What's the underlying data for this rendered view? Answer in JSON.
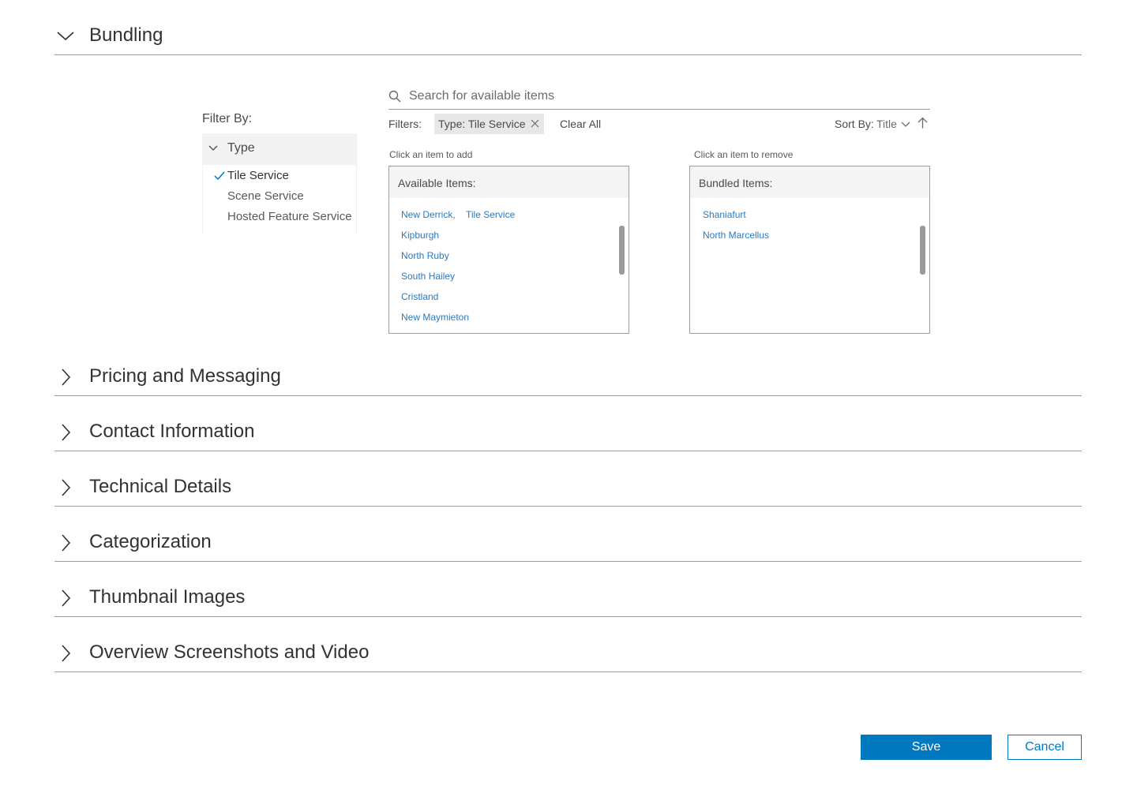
{
  "sections": {
    "bundling": {
      "title": "Bundling",
      "expanded": true
    },
    "pricing": {
      "title": "Pricing and Messaging"
    },
    "contact": {
      "title": "Contact Information"
    },
    "technical": {
      "title": "Technical Details"
    },
    "categorization": {
      "title": "Categorization"
    },
    "thumbnail": {
      "title": "Thumbnail Images"
    },
    "overview": {
      "title": "Overview Screenshots and Video"
    }
  },
  "filter": {
    "label": "Filter By:",
    "group_label": "Type",
    "options": [
      {
        "label": "Tile Service",
        "checked": true
      },
      {
        "label": "Scene Service",
        "checked": false
      },
      {
        "label": "Hosted Feature Service",
        "checked": false
      }
    ]
  },
  "search": {
    "placeholder": "Search for available items"
  },
  "filters_bar": {
    "label": "Filters:",
    "chip": "Type: Tile Service",
    "clear_all": "Clear All"
  },
  "sort": {
    "label": "Sort By:",
    "value": "Title"
  },
  "available": {
    "hint": "Click an item to add",
    "header": "Available Items:",
    "items": [
      "New Derrick,",
      "Kipburgh",
      "North Ruby",
      "South Hailey",
      "Cristland",
      "New Maymieton"
    ],
    "first_item_tag": "Tile Service"
  },
  "bundled": {
    "hint": "Click an item to remove",
    "header": "Bundled Items:",
    "items": [
      "Shaniafurt",
      "North Marcellus"
    ]
  },
  "actions": {
    "save": "Save",
    "cancel": "Cancel"
  },
  "colors": {
    "accent": "#0079c1",
    "link": "#2b7bbd",
    "text": "#323232",
    "divider": "#9e9e9e"
  }
}
